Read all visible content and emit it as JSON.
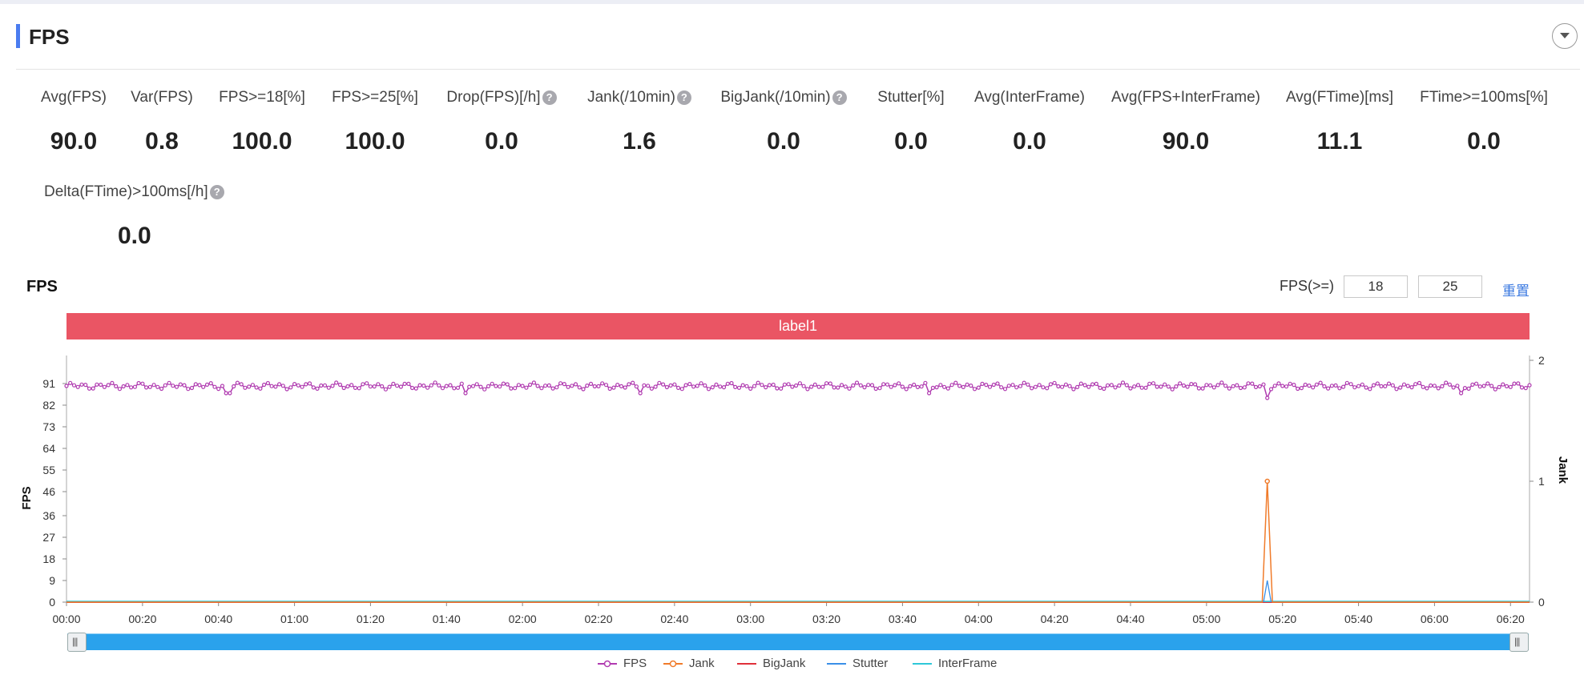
{
  "section": {
    "title": "FPS"
  },
  "metrics": [
    {
      "label": "Avg(FPS)",
      "value": "90.0",
      "help": false
    },
    {
      "label": "Var(FPS)",
      "value": "0.8",
      "help": false
    },
    {
      "label": "FPS>=18[%]",
      "value": "100.0",
      "help": false
    },
    {
      "label": "FPS>=25[%]",
      "value": "100.0",
      "help": false
    },
    {
      "label": "Drop(FPS)[/h]",
      "value": "0.0",
      "help": true
    },
    {
      "label": "Jank(/10min)",
      "value": "1.6",
      "help": true
    },
    {
      "label": "BigJank(/10min)",
      "value": "0.0",
      "help": true
    },
    {
      "label": "Stutter[%]",
      "value": "0.0",
      "help": false
    },
    {
      "label": "Avg(InterFrame)",
      "value": "0.0",
      "help": false
    },
    {
      "label": "Avg(FPS+InterFrame)",
      "value": "90.0",
      "help": false
    },
    {
      "label": "Avg(FTime)[ms]",
      "value": "11.1",
      "help": false
    },
    {
      "label": "FTime>=100ms[%]",
      "value": "0.0",
      "help": false
    },
    {
      "label": "Delta(FTime)>100ms[/h]",
      "value": "0.0",
      "help": true
    }
  ],
  "chart_header": {
    "title": "FPS",
    "threshold_label": "FPS(>=)",
    "threshold_1": "18",
    "threshold_2": "25",
    "reset_label": "重置"
  },
  "label_band": "label1",
  "colors": {
    "fps": "#b03bb0",
    "jank": "#f07b2a",
    "bigjank": "#e0303a",
    "stutter": "#3a8fe8",
    "interframe": "#2ec8d8",
    "label_band": "#ea5564",
    "accent": "#4a7cf0"
  },
  "chart_data": {
    "type": "line",
    "xlabel": "",
    "ylabel": "FPS",
    "y2label": "Jank",
    "x_ticks": [
      "00:00",
      "00:20",
      "00:40",
      "01:00",
      "01:20",
      "01:40",
      "02:00",
      "02:20",
      "02:40",
      "03:00",
      "03:20",
      "03:40",
      "04:00",
      "04:20",
      "04:40",
      "05:00",
      "05:20",
      "05:40",
      "06:00",
      "06:20"
    ],
    "x_range_seconds": [
      0,
      23100
    ],
    "y_ticks": [
      "0",
      "9",
      "18",
      "27",
      "36",
      "46",
      "55",
      "64",
      "73",
      "82",
      "91"
    ],
    "ylim": [
      0,
      100
    ],
    "y2_ticks": [
      "0",
      "1",
      "2"
    ],
    "y2lim": [
      0,
      2
    ],
    "legend": [
      "FPS",
      "Jank",
      "BigJank",
      "Stutter",
      "InterFrame"
    ],
    "legend_position": "bottom",
    "series": [
      {
        "name": "FPS",
        "axis": "left",
        "baseline": 90,
        "dip_times_seconds": [
          2550,
          6300,
          9050,
          13600,
          18960,
          22030
        ],
        "dip_values": [
          87,
          87,
          87,
          87,
          85,
          87
        ]
      },
      {
        "name": "Jank",
        "axis": "right",
        "x_seconds": [
          18880,
          18960,
          19040
        ],
        "values": [
          0,
          1,
          0
        ]
      },
      {
        "name": "BigJank",
        "axis": "right",
        "constant": 0
      },
      {
        "name": "Stutter",
        "axis": "left",
        "x_seconds": [
          18900,
          18960,
          19020
        ],
        "values": [
          0,
          9,
          0
        ]
      },
      {
        "name": "InterFrame",
        "axis": "left",
        "constant": 0
      }
    ]
  }
}
